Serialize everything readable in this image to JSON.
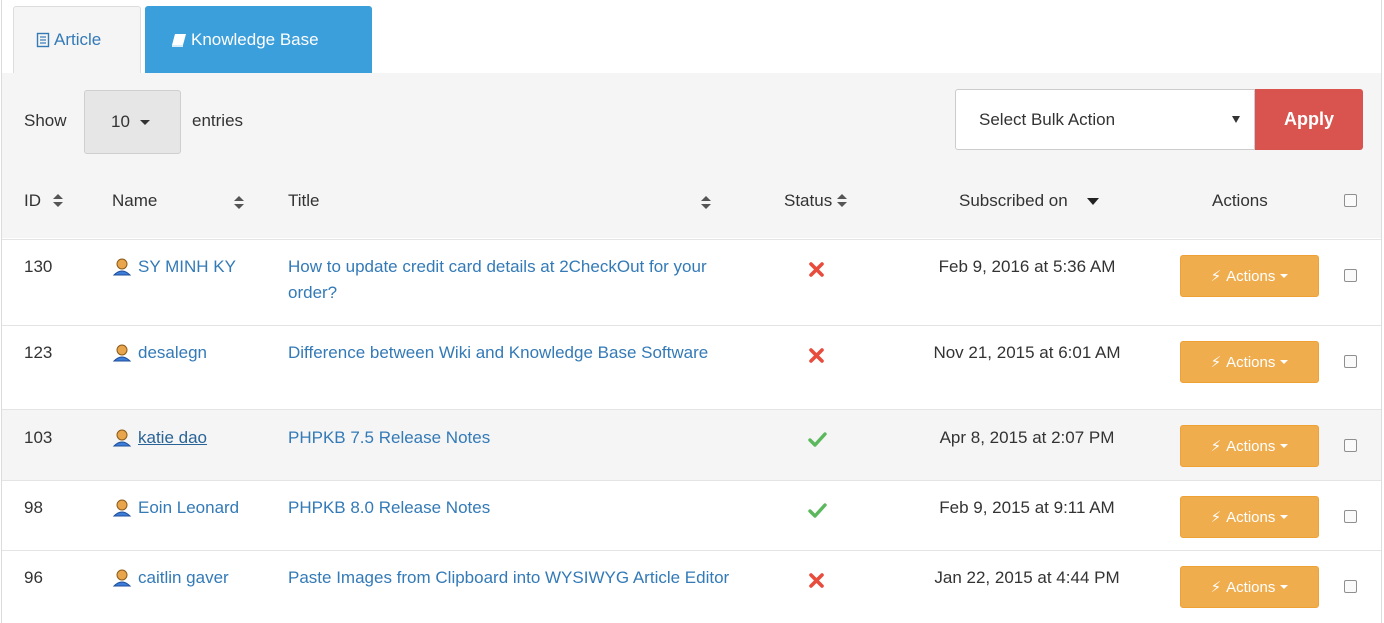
{
  "tabs": [
    {
      "label": "Article",
      "icon": "file-text-icon",
      "active": false
    },
    {
      "label": "Knowledge Base",
      "icon": "book-icon",
      "active": true
    }
  ],
  "toolbar": {
    "show_label": "Show",
    "page_length": "10",
    "entries_label": "entries",
    "bulk_action_value": "Select Bulk Action",
    "apply_label": "Apply"
  },
  "columns": {
    "id": "ID",
    "name": "Name",
    "title": "Title",
    "status": "Status",
    "subscribed": "Subscribed on",
    "actions": "Actions"
  },
  "rows": [
    {
      "id": "130",
      "name": "SY MINH KY",
      "title": "How to update credit card details at 2CheckOut for your order?",
      "status": "inactive",
      "date": "Feb 9, 2016 at 5:36 AM",
      "action": "Actions"
    },
    {
      "id": "123",
      "name": "desalegn",
      "title": "Difference between Wiki and Knowledge Base Software",
      "status": "inactive",
      "date": "Nov 21, 2015 at 6:01 AM",
      "action": "Actions"
    },
    {
      "id": "103",
      "name": "katie dao",
      "title": "PHPKB 7.5 Release Notes",
      "status": "active",
      "date": "Apr 8, 2015 at 2:07 PM",
      "action": "Actions"
    },
    {
      "id": "98",
      "name": "Eoin Leonard",
      "title": "PHPKB 8.0 Release Notes",
      "status": "active",
      "date": "Feb 9, 2015 at 9:11 AM",
      "action": "Actions"
    },
    {
      "id": "96",
      "name": "caitlin gaver",
      "title": "Paste Images from Clipboard into WYSIWYG Article Editor",
      "status": "inactive",
      "date": "Jan 22, 2015 at 4:44 PM",
      "action": "Actions"
    }
  ],
  "colors": {
    "link": "#337ab7",
    "active_tab": "#3b9fdb",
    "apply": "#d9534f",
    "actions_button": "#f0ad4e",
    "status_ok": "#5cb85c",
    "status_no": "#e74c3c"
  }
}
